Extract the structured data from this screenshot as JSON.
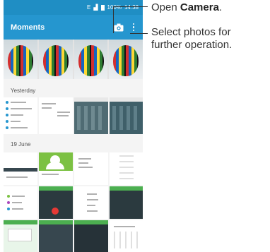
{
  "status_bar": {
    "signal": "E",
    "battery": "100%",
    "time": "14:38"
  },
  "app_bar": {
    "title": "Moments"
  },
  "sections": {
    "yesterday": "Yesterday",
    "june": "19 June"
  },
  "callouts": {
    "camera_prefix": "Open ",
    "camera_bold": "Camera",
    "camera_suffix": ".",
    "select_line1": "Select photos for",
    "select_line2": "further operation."
  },
  "colors": {
    "app_bar": "#2596cf",
    "status_bar": "#1f8ec4",
    "accent_green": "#7cc143"
  }
}
